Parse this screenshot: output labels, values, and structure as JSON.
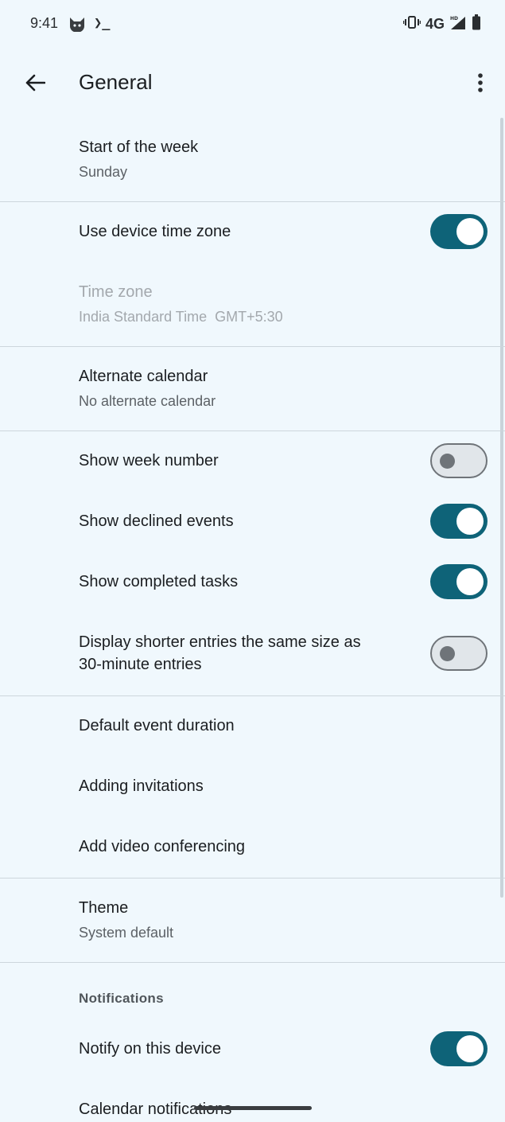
{
  "status_bar": {
    "time": "9:41",
    "terminal_glyph": "❯_",
    "network": "4G",
    "icons": [
      "cat-icon",
      "terminal-icon",
      "vibrate-icon",
      "hd-signal-icon",
      "battery-icon"
    ]
  },
  "app_bar": {
    "title": "General",
    "icons": [
      "back-arrow-icon",
      "more-vert-icon"
    ]
  },
  "settings": {
    "start_of_week": {
      "title": "Start of the week",
      "value": "Sunday"
    },
    "device_time_zone": {
      "title": "Use device time zone",
      "enabled": true
    },
    "time_zone": {
      "title": "Time zone",
      "value": "India Standard Time  GMT+5:30",
      "disabled": true
    },
    "alternate_calendar": {
      "title": "Alternate calendar",
      "value": "No alternate calendar"
    },
    "show_week_number": {
      "title": "Show week number",
      "enabled": false
    },
    "show_declined_events": {
      "title": "Show declined events",
      "enabled": true
    },
    "show_completed_tasks": {
      "title": "Show completed tasks",
      "enabled": true
    },
    "display_shorter_entries": {
      "title_line1": "Display shorter entries the same size as",
      "title_line2": "30-minute entries",
      "enabled": false
    },
    "default_event_duration": {
      "title": "Default event duration"
    },
    "adding_invitations": {
      "title": "Adding invitations"
    },
    "add_video_conferencing": {
      "title": "Add video conferencing"
    },
    "theme": {
      "title": "Theme",
      "value": "System default"
    },
    "notifications_header": "Notifications",
    "notify_on_device": {
      "title": "Notify on this device",
      "enabled": true
    },
    "calendar_notifications": {
      "title": "Calendar notifications"
    }
  },
  "colors": {
    "background": "#f0f8fd",
    "toggle_on": "#0e6378",
    "toggle_off_track": "#e1e6ea",
    "divider": "#cdd6dc"
  }
}
